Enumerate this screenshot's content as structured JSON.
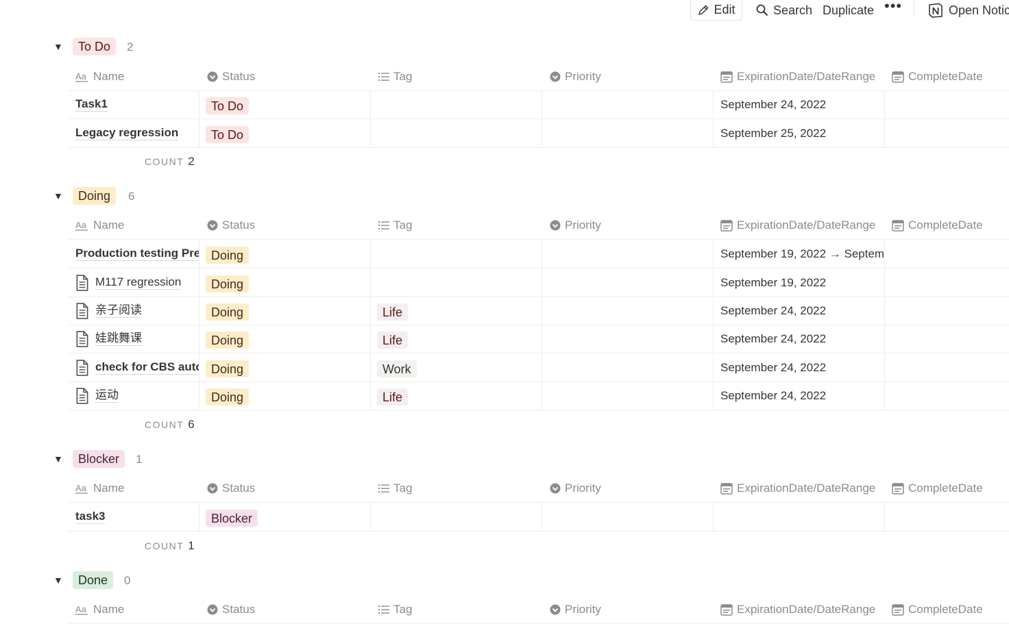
{
  "toolbar": {
    "edit": "Edit",
    "search": "Search",
    "duplicate": "Duplicate",
    "more": "•••",
    "open": "Open Notic"
  },
  "columns": {
    "name": "Name",
    "status": "Status",
    "tag": "Tag",
    "priority": "Priority",
    "expiration": "ExpirationDate/DateRange",
    "complete": "CompleteDate"
  },
  "count_label": "COUNT",
  "groups": [
    {
      "label": "To Do",
      "count": "2",
      "rows": [
        {
          "name": "Task1",
          "status": "To Do",
          "tag": "",
          "priority": "",
          "expiration": "September 24, 2022",
          "complete": ""
        },
        {
          "name": "Legacy regression",
          "status": "To Do",
          "tag": "",
          "priority": "",
          "expiration": "September 25, 2022",
          "complete": ""
        }
      ],
      "footer_count": "2"
    },
    {
      "label": "Doing",
      "count": "6",
      "rows": [
        {
          "name": "Production testing Prep",
          "status": "Doing",
          "tag": "",
          "priority": "",
          "expiration": "September 19, 2022 → Septem",
          "complete": ""
        },
        {
          "name": "M117 regression",
          "status": "Doing",
          "tag": "",
          "priority": "",
          "expiration": "September 19, 2022",
          "complete": ""
        },
        {
          "name": "亲子阅读",
          "status": "Doing",
          "tag": "Life",
          "priority": "",
          "expiration": "September 24, 2022",
          "complete": ""
        },
        {
          "name": "娃跳舞课",
          "status": "Doing",
          "tag": "Life",
          "priority": "",
          "expiration": "September 24, 2022",
          "complete": ""
        },
        {
          "name": "check for CBS auto",
          "status": "Doing",
          "tag": "Work",
          "priority": "",
          "expiration": "September 24, 2022",
          "complete": ""
        },
        {
          "name": "运动",
          "status": "Doing",
          "tag": "Life",
          "priority": "",
          "expiration": "September 24, 2022",
          "complete": ""
        }
      ],
      "footer_count": "6"
    },
    {
      "label": "Blocker",
      "count": "1",
      "rows": [
        {
          "name": "task3",
          "status": "Blocker",
          "tag": "",
          "priority": "",
          "expiration": "",
          "complete": ""
        }
      ],
      "footer_count": "1"
    },
    {
      "label": "Done",
      "count": "0",
      "rows": [],
      "footer_count": ""
    }
  ],
  "colors": {
    "todo_bg": "#fbe4e4",
    "doing_bg": "#fdecc8",
    "blocker_bg": "#f5e0e9",
    "done_bg": "#dbeddb",
    "life_bg": "#f4eeee",
    "work_bg": "#f1f1ef",
    "muted_text": "#8c8b88"
  }
}
